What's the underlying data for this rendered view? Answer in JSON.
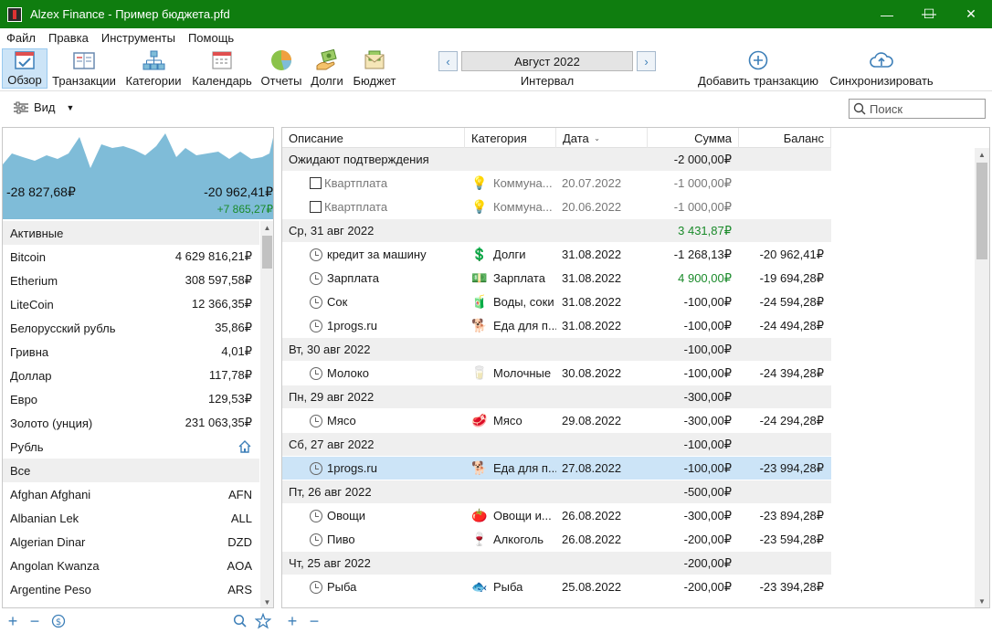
{
  "window": {
    "title": "Alzex Finance - Пример бюджета.pfd",
    "minimize": "—",
    "maximize": "☐",
    "close": "✕"
  },
  "menu": [
    "Файл",
    "Правка",
    "Инструменты",
    "Помощь"
  ],
  "toolbar": {
    "overview": "Обзор",
    "transactions": "Транзакции",
    "categories": "Категории",
    "calendar": "Календарь",
    "reports": "Отчеты",
    "debts": "Долги",
    "budget": "Бюджет",
    "add_transaction": "Добавить транзакцию",
    "sync": "Синхронизировать"
  },
  "period": {
    "month": "Август 2022",
    "label": "Интервал",
    "prev": "‹",
    "next": "›"
  },
  "view": {
    "label": "Вид"
  },
  "search": {
    "placeholder": "Поиск"
  },
  "summary": {
    "start_balance": "-28 827,68₽",
    "end_balance": "-20 962,41₽",
    "delta": "+7 865,27₽"
  },
  "accounts": {
    "active_header": "Активные",
    "active": [
      {
        "name": "Bitcoin",
        "value": "4 629 816,21₽"
      },
      {
        "name": "Etherium",
        "value": "308 597,58₽"
      },
      {
        "name": "LiteCoin",
        "value": "12 366,35₽"
      },
      {
        "name": "Белорусский рубль",
        "value": "35,86₽"
      },
      {
        "name": "Гривна",
        "value": "4,01₽"
      },
      {
        "name": "Доллар",
        "value": "117,78₽"
      },
      {
        "name": "Евро",
        "value": "129,53₽"
      },
      {
        "name": "Золото (унция)",
        "value": "231 063,35₽"
      },
      {
        "name": "Рубль",
        "value": ""
      }
    ],
    "all_header": "Все",
    "all": [
      {
        "name": "Afghan Afghani",
        "value": "AFN"
      },
      {
        "name": "Albanian Lek",
        "value": "ALL"
      },
      {
        "name": "Algerian Dinar",
        "value": "DZD"
      },
      {
        "name": "Angolan Kwanza",
        "value": "AOA"
      },
      {
        "name": "Argentine Peso",
        "value": "ARS"
      }
    ]
  },
  "table": {
    "headers": {
      "desc": "Описание",
      "cat": "Категория",
      "date": "Дата",
      "sum": "Сумма",
      "bal": "Баланс"
    },
    "rows": [
      {
        "type": "group",
        "desc": "Ожидают подтверждения",
        "sum": "-2 000,00₽"
      },
      {
        "type": "pending",
        "desc": "Квартплата",
        "icon": "💡",
        "cat": "Коммуна...",
        "date": "20.07.2022",
        "sum": "-1 000,00₽",
        "bal": ""
      },
      {
        "type": "pending",
        "desc": "Квартплата",
        "icon": "💡",
        "cat": "Коммуна...",
        "date": "20.06.2022",
        "sum": "-1 000,00₽",
        "bal": ""
      },
      {
        "type": "group",
        "desc": "Ср, 31 авг 2022",
        "sum": "3 431,87₽",
        "pos": true
      },
      {
        "type": "tx",
        "desc": "кредит за машину",
        "icon": "💲",
        "cat": "Долги",
        "date": "31.08.2022",
        "sum": "-1 268,13₽",
        "bal": "-20 962,41₽"
      },
      {
        "type": "tx",
        "desc": "Зарплата",
        "icon": "💵",
        "cat": "Зарплата",
        "date": "31.08.2022",
        "sum": "4 900,00₽",
        "bal": "-19 694,28₽",
        "pos": true
      },
      {
        "type": "tx",
        "desc": "Сок",
        "icon": "🧃",
        "cat": "Воды, соки",
        "date": "31.08.2022",
        "sum": "-100,00₽",
        "bal": "-24 594,28₽"
      },
      {
        "type": "tx",
        "desc": "1progs.ru",
        "icon": "🐕",
        "cat": "Еда для п...",
        "date": "31.08.2022",
        "sum": "-100,00₽",
        "bal": "-24 494,28₽"
      },
      {
        "type": "group",
        "desc": "Вт, 30 авг 2022",
        "sum": "-100,00₽"
      },
      {
        "type": "tx",
        "desc": "Молоко",
        "icon": "🥛",
        "cat": "Молочные",
        "date": "30.08.2022",
        "sum": "-100,00₽",
        "bal": "-24 394,28₽"
      },
      {
        "type": "group",
        "desc": "Пн, 29 авг 2022",
        "sum": "-300,00₽"
      },
      {
        "type": "tx",
        "desc": "Мясо",
        "icon": "🥩",
        "cat": "Мясо",
        "date": "29.08.2022",
        "sum": "-300,00₽",
        "bal": "-24 294,28₽"
      },
      {
        "type": "group",
        "desc": "Сб, 27 авг 2022",
        "sum": "-100,00₽"
      },
      {
        "type": "tx",
        "desc": "1progs.ru",
        "icon": "🐕",
        "cat": "Еда для п...",
        "date": "27.08.2022",
        "sum": "-100,00₽",
        "bal": "-23 994,28₽",
        "selected": true
      },
      {
        "type": "group",
        "desc": "Пт, 26 авг 2022",
        "sum": "-500,00₽"
      },
      {
        "type": "tx",
        "desc": "Овощи",
        "icon": "🍅",
        "cat": "Овощи и...",
        "date": "26.08.2022",
        "sum": "-300,00₽",
        "bal": "-23 894,28₽"
      },
      {
        "type": "tx",
        "desc": "Пиво",
        "icon": "🍷",
        "cat": "Алкоголь",
        "date": "26.08.2022",
        "sum": "-200,00₽",
        "bal": "-23 594,28₽"
      },
      {
        "type": "group",
        "desc": "Чт, 25 авг 2022",
        "sum": "-200,00₽"
      },
      {
        "type": "tx",
        "desc": "Рыба",
        "icon": "🐟",
        "cat": "Рыба",
        "date": "25.08.2022",
        "sum": "-200,00₽",
        "bal": "-23 394,28₽"
      }
    ]
  },
  "colors": {
    "titlebar": "#0f7d0f",
    "accent": "#3d7fb8",
    "positive": "#1a8a2a",
    "chart_fill": "#7fbcd8",
    "selected_row": "#cce4f7"
  }
}
